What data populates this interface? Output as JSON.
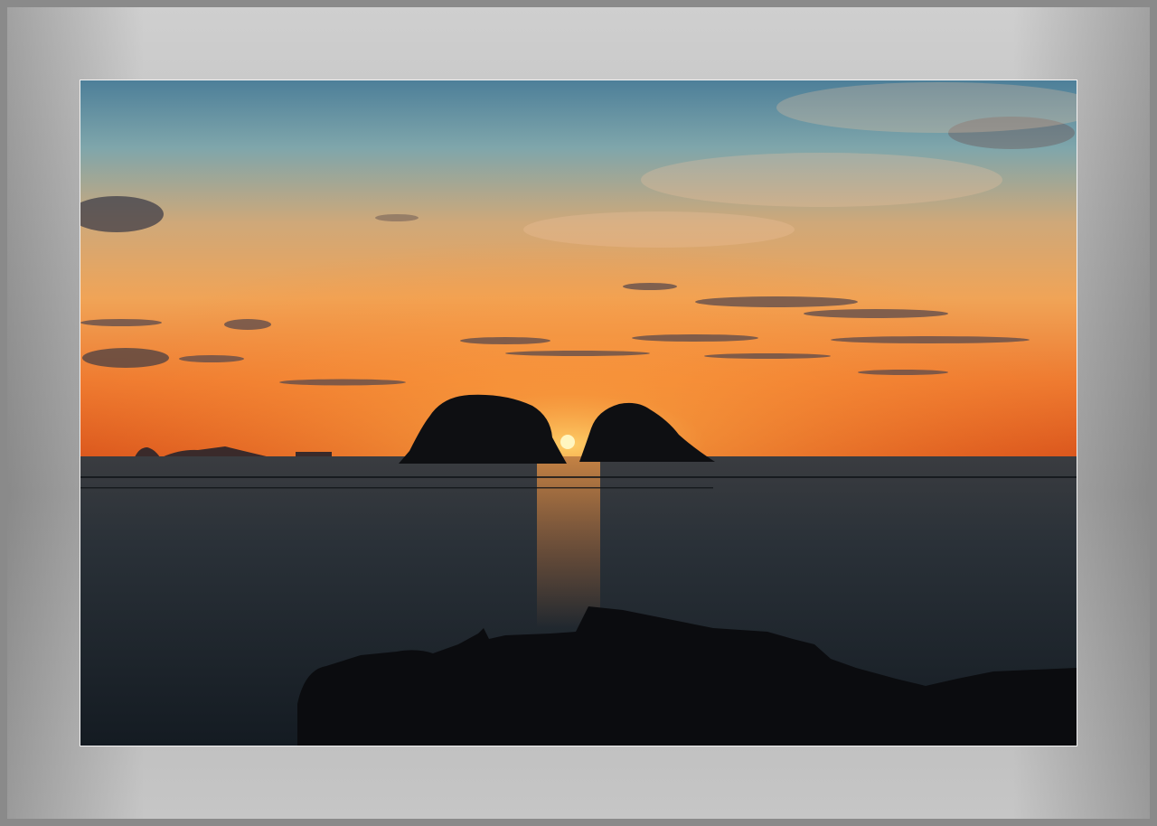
{
  "image": {
    "subject": "sunset-over-sea-with-two-islets",
    "colors": {
      "frame": "#b8b8b8",
      "sky_top": "#5b8fa6",
      "sky_mid": "#e9a063",
      "horizon": "#e8641f",
      "sun": "#fff2a8",
      "sea": "#1c242c",
      "silhouette": "#0d0f12"
    }
  }
}
